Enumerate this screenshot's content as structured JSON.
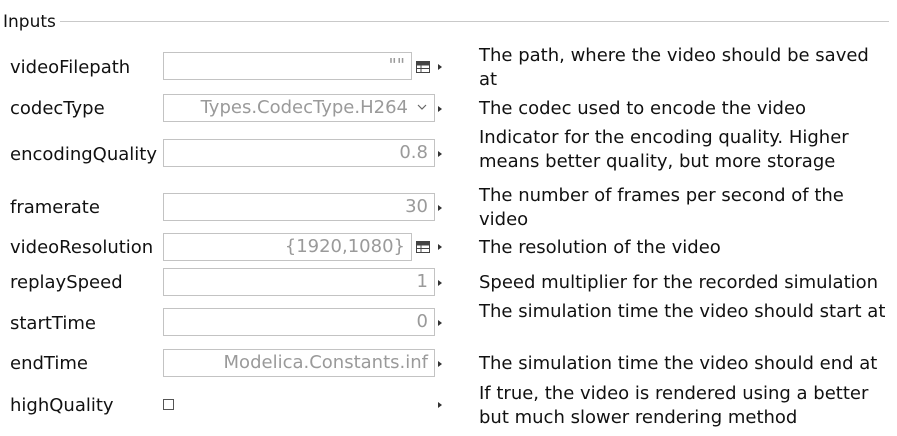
{
  "group": {
    "title": "Inputs"
  },
  "params": [
    {
      "name": "videoFilepath",
      "value": "\"\"",
      "description": "The path, where the video should be saved at"
    },
    {
      "name": "codecType",
      "value": "Types.CodecType.H264",
      "description": "The codec used to encode the video"
    },
    {
      "name": "encodingQuality",
      "value": "0.8",
      "description": "Indicator for the encoding quality. Higher means better quality, but more storage space"
    },
    {
      "name": "framerate",
      "value": "30",
      "description": "The number of frames per second of the video"
    },
    {
      "name": "videoResolution",
      "value": "{1920,1080}",
      "description": "The resolution of the video"
    },
    {
      "name": "replaySpeed",
      "value": "1",
      "description": "Speed multiplier for the recorded simulation"
    },
    {
      "name": "startTime",
      "value": "0",
      "description": "The simulation time the video should start at"
    },
    {
      "name": "endTime",
      "value": "Modelica.Constants.inf",
      "description": "The simulation time the video should end at"
    },
    {
      "name": "highQuality",
      "checked": false,
      "description": "If true, the video is rendered using a better but much slower rendering method"
    }
  ],
  "icons": {
    "table": "table-icon",
    "dropdown": "chevron-down-icon",
    "menu_arrow": "menu-arrow-icon"
  },
  "colors": {
    "border": "#c3c3c3",
    "value_text": "#9a9a9a",
    "rule": "#c9c9c9"
  }
}
